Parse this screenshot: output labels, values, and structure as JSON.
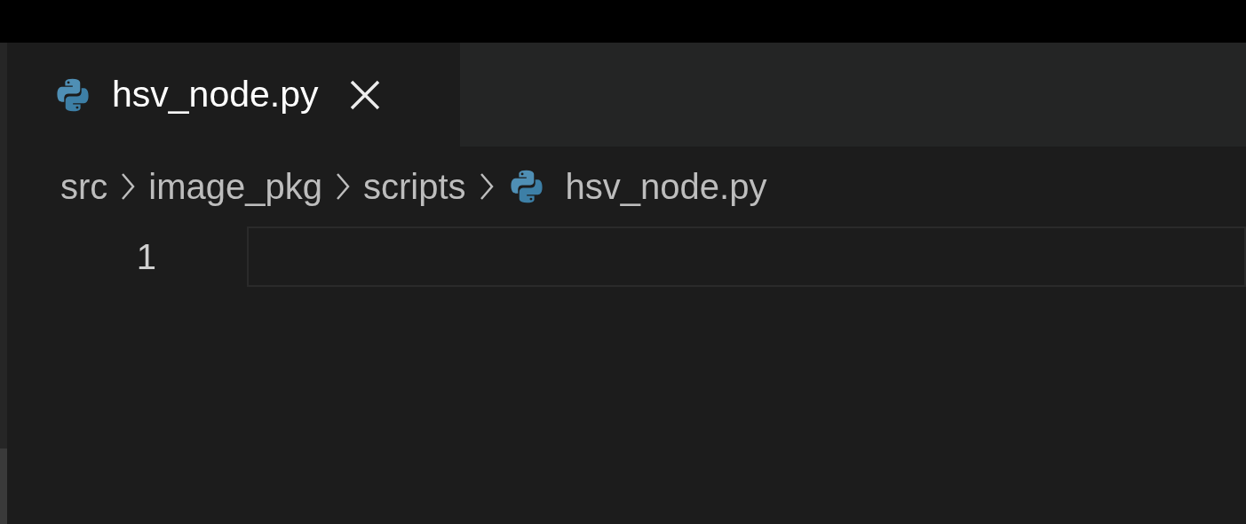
{
  "tab": {
    "label": "hsv_node.py",
    "selected": true
  },
  "breadcrumb": [
    {
      "label": "src",
      "kind": "folder"
    },
    {
      "label": "image_pkg",
      "kind": "folder"
    },
    {
      "label": "scripts",
      "kind": "folder"
    },
    {
      "label": "hsv_node.py",
      "kind": "file"
    }
  ],
  "editor": {
    "lines": [
      {
        "number": "1",
        "current": true
      }
    ]
  }
}
